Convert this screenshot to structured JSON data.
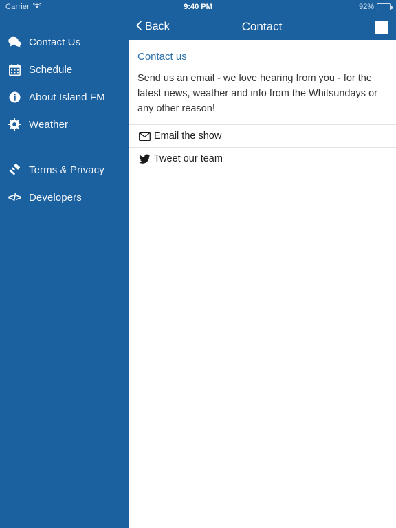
{
  "statusbar": {
    "carrier": "Carrier",
    "wifi_icon": "wifi-icon",
    "time": "9:40 PM",
    "battery_percent": "92%",
    "battery_icon": "battery-icon"
  },
  "navbar": {
    "back_label": "Back",
    "back_icon": "chevron-left-icon",
    "title": "Contact",
    "action_icon": "stop-square-icon"
  },
  "sidebar": {
    "background": "#1b609f",
    "items": [
      {
        "label": "Contact Us",
        "icon": "comments-icon"
      },
      {
        "label": "Schedule",
        "icon": "calendar-icon"
      },
      {
        "label": "About Island FM",
        "icon": "info-circle-icon"
      },
      {
        "label": "Weather",
        "icon": "gear-icon"
      },
      {
        "label": "Terms & Privacy",
        "icon": "gavel-icon"
      },
      {
        "label": "Developers",
        "icon": "code-icon"
      }
    ]
  },
  "content": {
    "heading": "Contact us",
    "heading_color": "#2d72ad",
    "body": "Send us an email - we love hearing from you - for the latest news, weather and info from the Whitsundays or any other reason!",
    "rows": [
      {
        "label": "Email the show",
        "icon": "envelope-icon"
      },
      {
        "label": "Tweet our team",
        "icon": "twitter-icon"
      }
    ]
  }
}
